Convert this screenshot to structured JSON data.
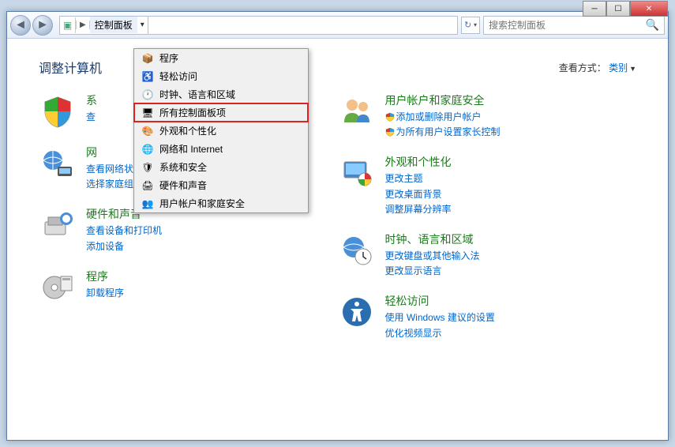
{
  "window": {
    "breadcrumb_label": "控制面板",
    "search_placeholder": "搜索控制面板"
  },
  "heading": "调整计算机",
  "viewmode": {
    "label": "查看方式：",
    "value": "类别"
  },
  "left_categories": [
    {
      "title": "系",
      "links": [
        "查"
      ],
      "icon": "shield-color"
    },
    {
      "title": "网",
      "links": [
        "查看网络状态和任务",
        "选择家庭组和共享选项"
      ],
      "icon": "network"
    },
    {
      "title": "硬件和声音",
      "links": [
        "查看设备和打印机",
        "添加设备"
      ],
      "icon": "hardware"
    },
    {
      "title": "程序",
      "links": [
        "卸载程序"
      ],
      "icon": "programs"
    }
  ],
  "right_categories": [
    {
      "title": "用户帐户和家庭安全",
      "links": [
        {
          "text": "添加或删除用户帐户",
          "shield": true
        },
        {
          "text": "为所有用户设置家长控制",
          "shield": true
        }
      ],
      "icon": "users"
    },
    {
      "title": "外观和个性化",
      "links": [
        "更改主题",
        "更改桌面背景",
        "调整屏幕分辨率"
      ],
      "icon": "appearance"
    },
    {
      "title": "时钟、语言和区域",
      "links": [
        "更改键盘或其他输入法",
        "更改显示语言"
      ],
      "icon": "clock"
    },
    {
      "title": "轻松访问",
      "links": [
        "使用 Windows 建议的设置",
        "优化视频显示"
      ],
      "icon": "ease"
    }
  ],
  "dropdown": [
    {
      "label": "程序",
      "icon": "📦"
    },
    {
      "label": "轻松访问",
      "icon": "♿"
    },
    {
      "label": "时钟、语言和区域",
      "icon": "🕐"
    },
    {
      "label": "所有控制面板项",
      "icon": "🖥",
      "highlight": true
    },
    {
      "label": "外观和个性化",
      "icon": "🎨"
    },
    {
      "label": "网络和 Internet",
      "icon": "🌐"
    },
    {
      "label": "系统和安全",
      "icon": "🛡"
    },
    {
      "label": "硬件和声音",
      "icon": "🖨"
    },
    {
      "label": "用户帐户和家庭安全",
      "icon": "👥"
    }
  ]
}
